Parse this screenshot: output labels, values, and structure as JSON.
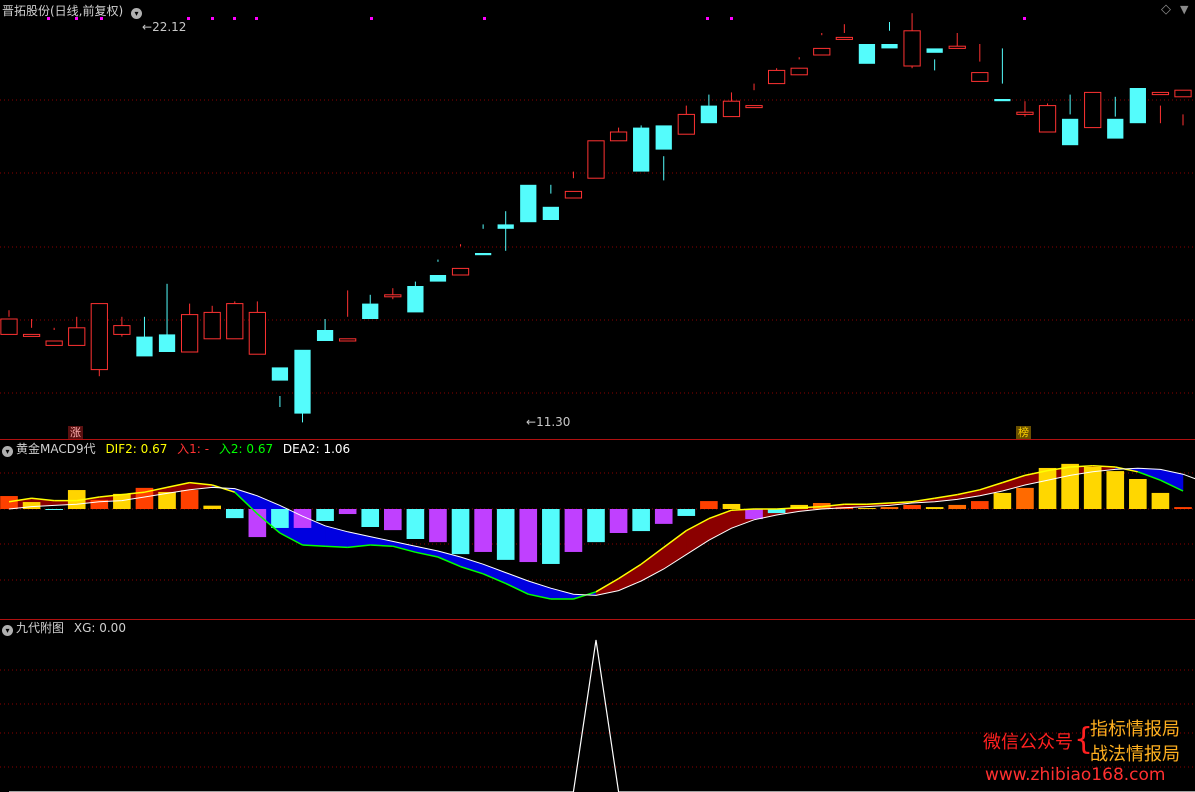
{
  "colors": {
    "up": "#ff3232",
    "down": "#54fcfc",
    "grid": "#8b0000",
    "divider": "#b01010",
    "text": "#c8c8c8",
    "yellow": "#ffff00",
    "green": "#00ff00",
    "red": "#ff3232",
    "white": "#ffffff",
    "blue": "#0000e0",
    "darkred": "#8b0000",
    "magenta": "#ff00ff",
    "violet": "#c040ff",
    "orange": "#ff6a00",
    "gold": "#ffd700"
  },
  "header": {
    "stock_title": "晋拓股份(日线,前复权)",
    "chevron_icon": "chevron-down-icon",
    "diamond_icon": "diamond-icon",
    "scroll_icon": "chevron-down-icon"
  },
  "price_labels": {
    "high": "22.12",
    "low": "11.30"
  },
  "markers": {
    "zhang": "涨",
    "bang": "榜"
  },
  "macd": {
    "name": "黄金MACD9代",
    "dif_label": "DIF2:",
    "dif_value": "0.67",
    "in1_label": "入1:",
    "in1_value": "-",
    "in2_label": "入2:",
    "in2_value": "0.67",
    "dea_label": "DEA2:",
    "dea_value": "1.06"
  },
  "sub": {
    "name": "九代附图",
    "xg_label": "XG:",
    "xg_value": "0.00"
  },
  "watermark": {
    "left": "微信公众号",
    "brace": "{",
    "line1": "指标情报局",
    "line2": "战法情报局",
    "url": "www.zhibiao168.com"
  },
  "candles": [
    [
      24.0,
      27.5,
      28.0,
      29.5
    ],
    [
      24.0,
      24.0,
      25.5,
      27.5
    ],
    [
      21.5,
      22.5,
      25.0,
      25.5
    ],
    [
      21.5,
      25.5,
      21.5,
      28.0
    ],
    [
      16.0,
      31.0,
      14.5,
      30.0
    ],
    [
      24.0,
      26.0,
      23.5,
      28.0
    ],
    [
      23.5,
      19.0,
      22.0,
      28.0
    ],
    [
      24.0,
      20.0,
      20.5,
      35.5
    ],
    [
      20.0,
      28.5,
      20.5,
      31.0
    ],
    [
      23.0,
      29.0,
      25.0,
      30.5
    ],
    [
      23.0,
      31.0,
      30.0,
      31.5
    ],
    [
      19.5,
      29.0,
      27.5,
      31.5
    ],
    [
      16.5,
      13.5,
      10.0,
      7.5
    ],
    [
      20.5,
      6.0,
      4.0,
      9.5
    ],
    [
      25.0,
      22.5,
      23.5,
      27.5
    ],
    [
      22.5,
      23.0,
      28.0,
      34.0
    ],
    [
      31.0,
      27.5,
      31.0,
      33.0
    ],
    [
      33.0,
      33.0,
      32.0,
      34.5
    ],
    [
      35.0,
      29.0,
      34.5,
      36.0
    ],
    [
      37.5,
      36.0,
      40.5,
      41.0
    ],
    [
      37.5,
      39.0,
      44.5,
      44.0
    ],
    [
      42.5,
      42.0,
      48.0,
      49.0
    ],
    [
      49.0,
      48.0,
      43.0,
      52.0
    ],
    [
      58.0,
      49.5,
      55.5,
      56.0
    ],
    [
      53.0,
      50.0,
      56.0,
      58.0
    ],
    [
      55.0,
      56.5,
      61.0,
      59.5
    ],
    [
      59.5,
      68.0,
      61.5,
      65.0
    ],
    [
      68.0,
      70.0,
      68.5,
      71.0
    ],
    [
      71.0,
      61.0,
      66.0,
      71.5
    ],
    [
      71.5,
      66.0,
      64.5,
      59.0
    ],
    [
      69.5,
      74.0,
      71.5,
      76.0
    ],
    [
      76.0,
      72.0,
      76.0,
      78.5
    ],
    [
      73.5,
      77.0,
      75.0,
      79.0
    ],
    [
      76.0,
      76.0,
      79.5,
      81.0
    ],
    [
      81.0,
      84.0,
      81.0,
      84.5
    ],
    [
      83.0,
      84.5,
      86.5,
      87.0
    ],
    [
      87.5,
      89.0,
      92.5,
      92.0
    ],
    [
      91.5,
      91.5,
      94.5,
      92.5
    ],
    [
      90.0,
      85.5,
      91.0,
      91.0
    ],
    [
      90.0,
      89.0,
      95.0,
      93.0
    ],
    [
      85.0,
      93.0,
      84.5,
      97.0
    ],
    [
      89.0,
      88.0,
      84.0,
      86.5
    ],
    [
      89.0,
      89.5,
      92.5,
      89.0
    ],
    [
      81.5,
      83.5,
      90.0,
      86.0
    ],
    [
      77.5,
      77.0,
      89.0,
      81.0
    ],
    [
      74.0,
      74.5,
      77.0,
      73.5
    ],
    [
      70.0,
      76.0,
      70.5,
      76.5
    ],
    [
      73.0,
      67.0,
      74.0,
      78.5
    ],
    [
      71.0,
      79.0,
      71.0,
      75.0
    ],
    [
      73.0,
      68.5,
      73.5,
      78.0
    ],
    [
      80.0,
      72.0,
      74.0,
      74.0
    ],
    [
      78.5,
      79.0,
      72.0,
      76.0
    ],
    [
      78.0,
      79.5,
      74.0,
      71.5
    ]
  ],
  "macd_bars": [
    0.54,
    0.29,
    -0.03,
    0.79,
    0.38,
    0.63,
    0.88,
    0.71,
    0.79,
    0.14,
    -0.38,
    -1.17,
    -0.79,
    -0.79,
    -0.5,
    -0.21,
    -0.75,
    -0.88,
    -1.25,
    -1.38,
    -1.88,
    -1.79,
    -2.12,
    -2.21,
    -2.29,
    -1.79,
    -1.38,
    -1.0,
    -0.92,
    -0.62,
    -0.29,
    0.33,
    0.21,
    -0.42,
    -0.17,
    0.17,
    0.25,
    0.08,
    0.04,
    0.08,
    0.17,
    0.08,
    0.17,
    0.33,
    0.67,
    0.88,
    1.71,
    1.88,
    1.75,
    1.58,
    1.25,
    0.67,
    0.08,
    0.29
  ],
  "dif": [
    0.3,
    0.45,
    0.35,
    0.35,
    0.5,
    0.6,
    0.7,
    0.9,
    1.1,
    1.0,
    0.7,
    -0.2,
    -1.0,
    -1.5,
    -1.55,
    -1.6,
    -1.5,
    -1.55,
    -1.8,
    -2.0,
    -2.4,
    -2.7,
    -3.1,
    -3.55,
    -3.75,
    -3.75,
    -3.45,
    -2.9,
    -2.3,
    -1.6,
    -0.9,
    -0.4,
    -0.05,
    0.0,
    0.0,
    0.05,
    0.1,
    0.2,
    0.2,
    0.25,
    0.3,
    0.45,
    0.6,
    0.8,
    1.1,
    1.4,
    1.6,
    1.75,
    1.8,
    1.75,
    1.55,
    1.2,
    0.75,
    0.6
  ],
  "dea": [
    0.0,
    0.1,
    0.15,
    0.2,
    0.3,
    0.35,
    0.5,
    0.65,
    0.8,
    0.9,
    0.85,
    0.55,
    0.15,
    -0.3,
    -0.7,
    -0.95,
    -1.15,
    -1.35,
    -1.55,
    -1.75,
    -2.0,
    -2.3,
    -2.65,
    -3.0,
    -3.3,
    -3.55,
    -3.6,
    -3.4,
    -3.0,
    -2.5,
    -1.9,
    -1.3,
    -0.8,
    -0.45,
    -0.25,
    -0.1,
    0.0,
    0.05,
    0.1,
    0.15,
    0.25,
    0.3,
    0.4,
    0.55,
    0.75,
    1.0,
    1.2,
    1.4,
    1.55,
    1.65,
    1.7,
    1.65,
    1.45,
    1.1
  ],
  "xg": [
    0,
    0,
    0,
    0,
    0,
    0,
    0,
    0,
    0,
    0,
    0,
    0,
    0,
    0,
    0,
    0,
    0,
    0,
    0,
    0,
    0,
    0,
    0,
    0,
    0,
    0,
    1,
    0,
    0,
    0,
    0,
    0,
    0,
    0,
    0,
    0,
    0,
    0,
    0,
    0,
    0,
    0,
    0,
    0,
    0,
    0,
    0,
    0,
    0,
    0,
    0,
    0,
    0,
    0
  ]
}
